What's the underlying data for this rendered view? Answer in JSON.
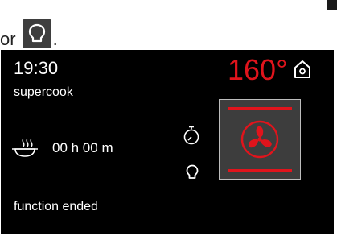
{
  "doc": {
    "prefix": "or",
    "suffix": ".",
    "icon": "bulb-icon"
  },
  "display": {
    "clock": "19:30",
    "program": "supercook",
    "temperature": "160°",
    "timer": "00 h 00 m",
    "status": "function ended",
    "icons": [
      "home-icon",
      "dish-icon",
      "stopwatch-icon",
      "bulb-icon",
      "fan-icon"
    ]
  },
  "colors": {
    "screen_background": "#000000",
    "accent_red": "#e0141c",
    "tile_background": "#3d3d3d",
    "tile_border": "#bdbdbd",
    "doc_icon_background": "#3e3e3e"
  }
}
